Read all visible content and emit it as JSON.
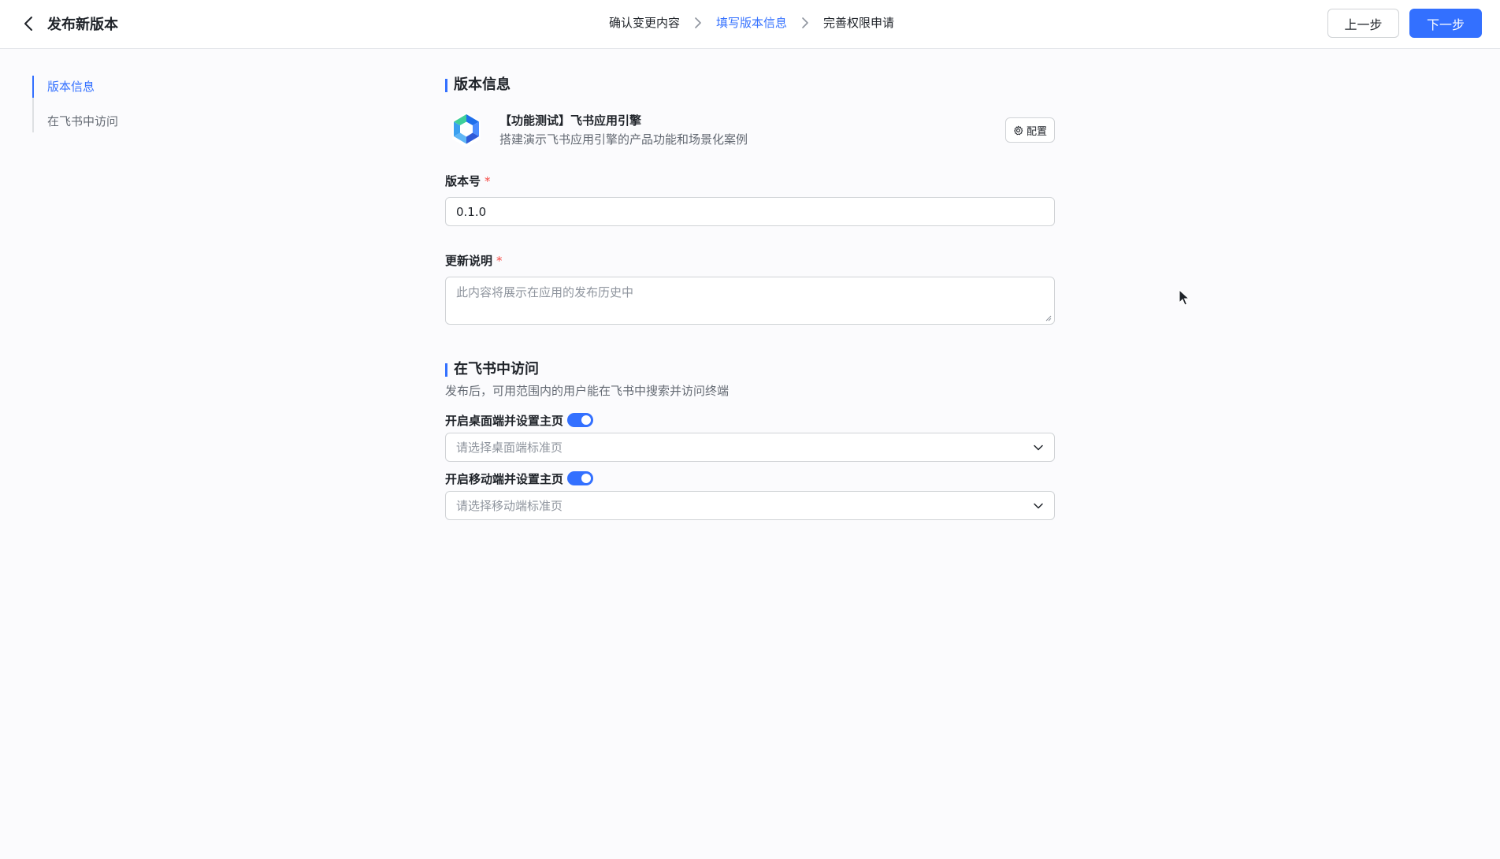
{
  "header": {
    "title": "发布新版本",
    "steps": [
      {
        "label": "确认变更内容",
        "active": false
      },
      {
        "label": "填写版本信息",
        "active": true
      },
      {
        "label": "完善权限申请",
        "active": false
      }
    ],
    "prev_label": "上一步",
    "next_label": "下一步"
  },
  "anchor_nav": {
    "items": [
      {
        "label": "版本信息",
        "active": true
      },
      {
        "label": "在飞书中访问",
        "active": false
      }
    ]
  },
  "version_section": {
    "title": "版本信息",
    "app": {
      "name": "【功能测试】飞书应用引擎",
      "description": "搭建演示飞书应用引擎的产品功能和场景化案例",
      "config_label": "配置"
    },
    "version_label": "版本号",
    "version_value": "0.1.0",
    "notes_label": "更新说明",
    "notes_placeholder": "此内容将展示在应用的发布历史中"
  },
  "access_section": {
    "title": "在飞书中访问",
    "description": "发布后，可用范围内的用户能在飞书中搜索并访问终端",
    "desktop_toggle_label": "开启桌面端并设置主页",
    "desktop_toggle_on": true,
    "desktop_select_placeholder": "请选择桌面端标准页",
    "mobile_toggle_label": "开启移动端并设置主页",
    "mobile_toggle_on": true,
    "mobile_select_placeholder": "请选择移动端标准页"
  },
  "colors": {
    "accent": "#3370ff",
    "required": "#f54a45",
    "text_primary": "#1f2329",
    "text_secondary": "#646a73",
    "placeholder": "#8f959e"
  }
}
